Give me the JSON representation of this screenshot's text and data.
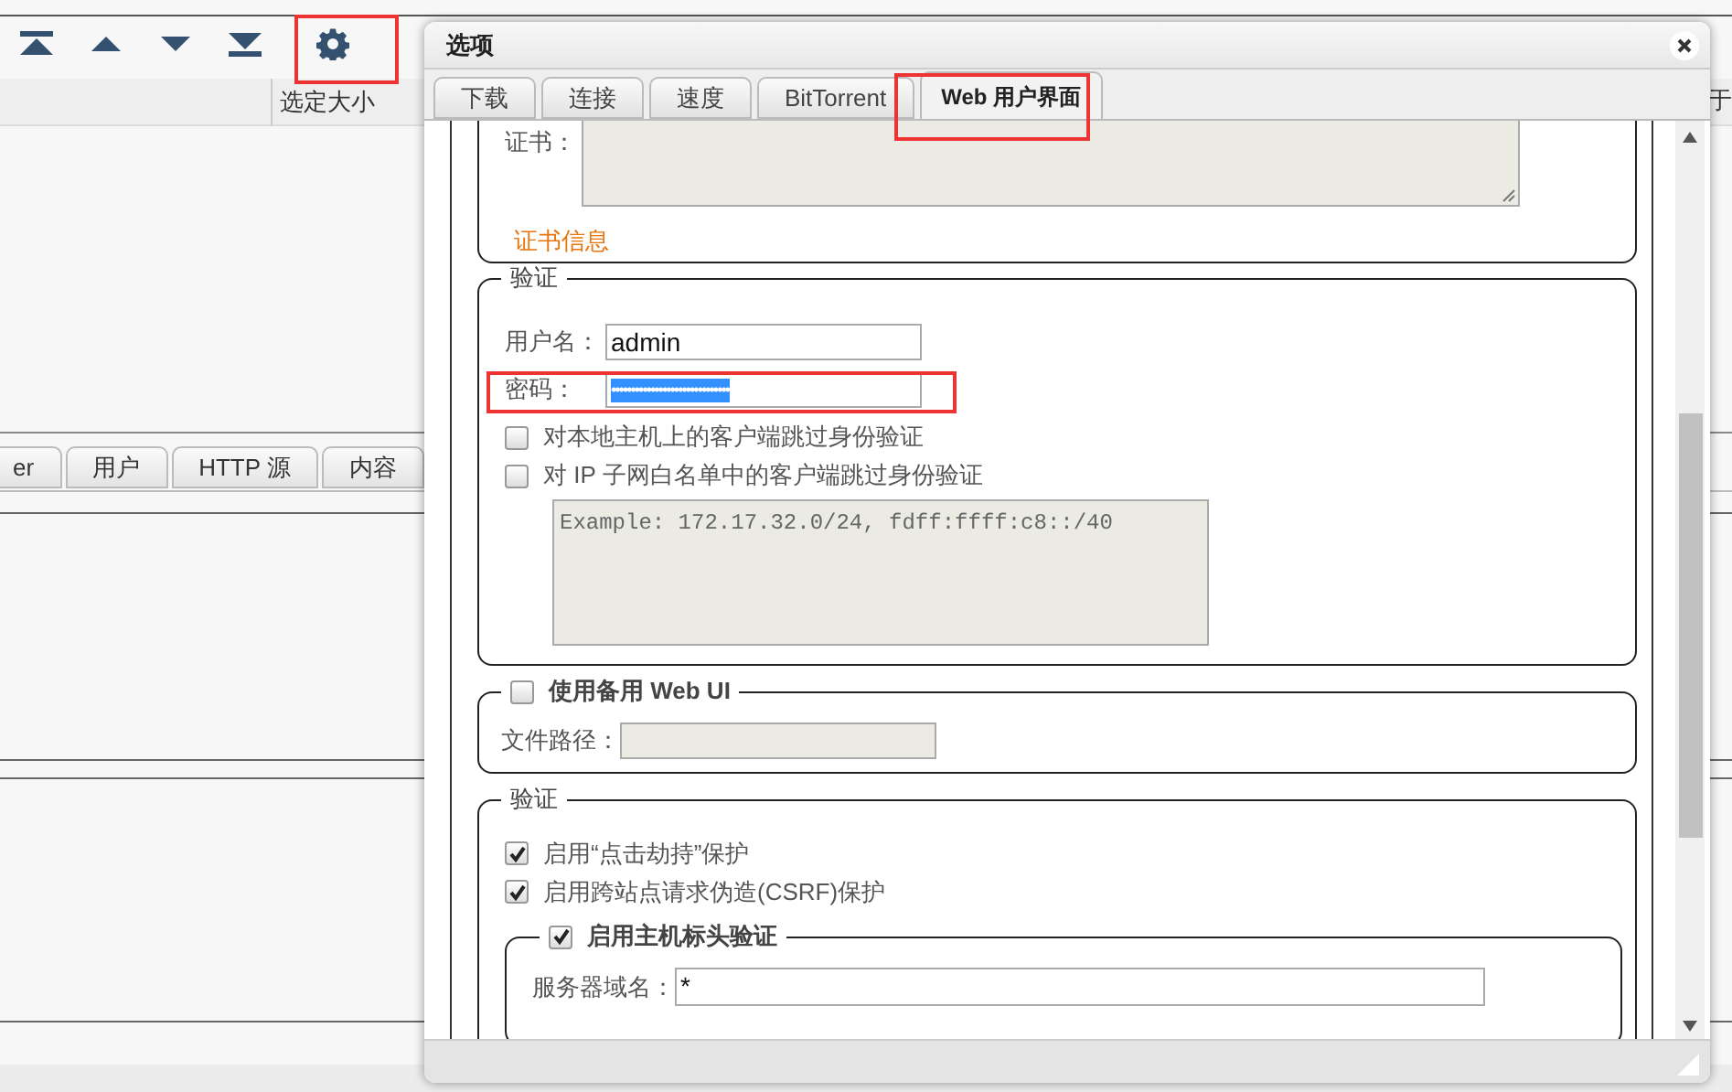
{
  "torrent_table": {
    "columns": [
      "选定大小",
      "于"
    ]
  },
  "detail_tabs": [
    {
      "label": "er"
    },
    {
      "label": "用户"
    },
    {
      "label": "HTTP 源"
    },
    {
      "label": "内容"
    }
  ],
  "dialog": {
    "title": "选项",
    "tabs": [
      {
        "label": "下载",
        "selected": false
      },
      {
        "label": "连接",
        "selected": false
      },
      {
        "label": "速度",
        "selected": false
      },
      {
        "label": "BitTorrent",
        "selected": false
      },
      {
        "label": "Web 用户界面",
        "selected": true
      }
    ],
    "certificate": {
      "label": "证书：",
      "link": "证书信息"
    },
    "authentication": {
      "legend": "验证",
      "username_label": "用户名：",
      "username": "admin",
      "password_label": "密码：",
      "password": "••••••••••••••••••••••••••••••",
      "password_selected": true,
      "options": [
        {
          "label": "对本地主机上的客户端跳过身份验证",
          "checked": false
        },
        {
          "label": "对 IP 子网白名单中的客户端跳过身份验证",
          "checked": false
        }
      ],
      "whitelist_placeholder": "Example: 172.17.32.0/24, fdff:ffff:c8::/40"
    },
    "alternative_webui": {
      "label": "使用备用 Web UI",
      "checked": false,
      "path_label": "文件路径："
    },
    "security": {
      "legend": "验证",
      "options": [
        {
          "label": "启用“点击劫持”保护",
          "checked": true
        },
        {
          "label": "启用跨站点请求伪造(CSRF)保护",
          "checked": true
        }
      ],
      "host_header": {
        "label": "启用主机标头验证",
        "checked": true,
        "domain_label": "服务器域名：",
        "domain": "*"
      }
    }
  }
}
